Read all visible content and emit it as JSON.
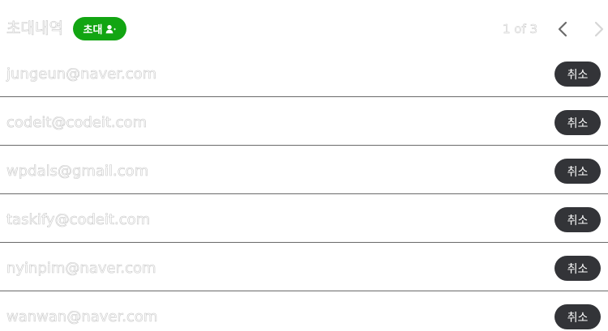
{
  "header": {
    "title": "초대내역",
    "invite_button_label": "초대",
    "invite_icon": "add-user-icon",
    "pager_text": "1 of 3",
    "prev_icon": "chevron-left-icon",
    "next_icon": "chevron-right-icon"
  },
  "colors": {
    "invite_button": "#12a512",
    "cancel_button": "#333438",
    "divider": "#6a6a6a"
  },
  "invites": [
    {
      "email": "jungeun@naver.com",
      "cancel_label": "취소"
    },
    {
      "email": "codeit@codeit.com",
      "cancel_label": "취소"
    },
    {
      "email": "wpdals@gmail.com",
      "cancel_label": "취소"
    },
    {
      "email": "taskify@codeit.com",
      "cancel_label": "취소"
    },
    {
      "email": "nyinpim@naver.com",
      "cancel_label": "취소"
    },
    {
      "email": "wanwan@naver.com",
      "cancel_label": "취소"
    }
  ]
}
